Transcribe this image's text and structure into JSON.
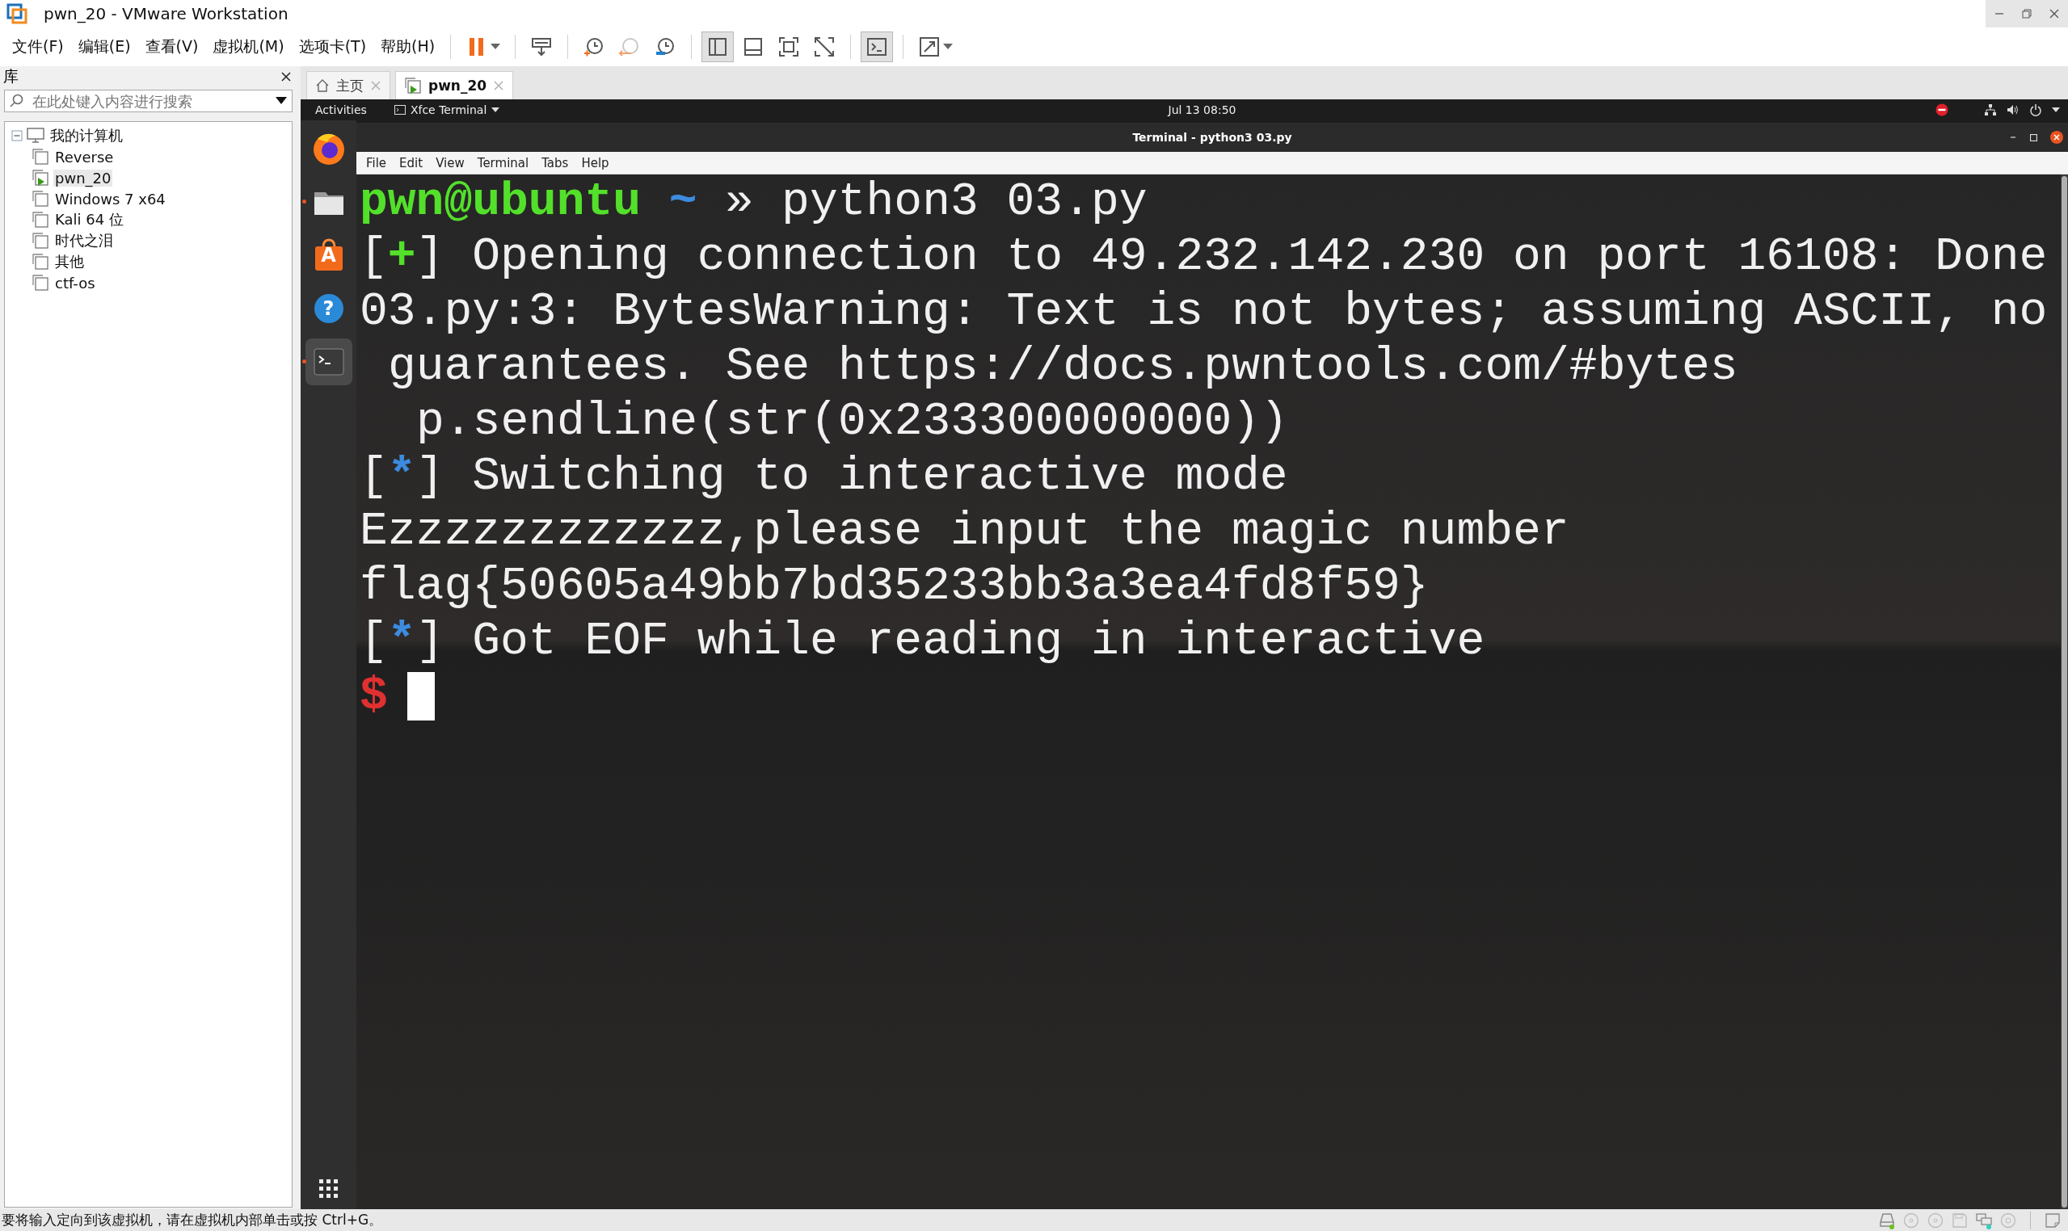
{
  "window": {
    "title": "pwn_20 - VMware Workstation"
  },
  "menu": [
    "文件(F)",
    "编辑(E)",
    "查看(V)",
    "虚拟机(M)",
    "选项卡(T)",
    "帮助(H)"
  ],
  "toolbar": [
    {
      "pressed": false
    },
    {
      "pressed": false
    },
    {
      "pressed": false
    },
    {
      "pressed": false
    },
    {
      "pressed": false
    },
    {
      "pressed": true
    },
    {
      "pressed": false
    },
    {
      "pressed": false
    },
    {
      "pressed": false
    },
    {
      "pressed": true
    },
    {
      "pressed": false
    }
  ],
  "library": {
    "title": "库",
    "search": {
      "placeholder": "在此处键入内容进行搜索"
    },
    "tree": [
      {
        "label": "我的计算机",
        "expanded": true,
        "children": [
          {
            "label": "Reverse",
            "selected": false,
            "running": false
          },
          {
            "label": "pwn_20",
            "selected": true,
            "running": true
          },
          {
            "label": "Windows 7 x64",
            "selected": false,
            "running": false
          },
          {
            "label": "Kali 64 位",
            "selected": false,
            "running": false
          },
          {
            "label": "时代之泪",
            "selected": false,
            "running": false
          },
          {
            "label": "其他",
            "selected": false,
            "running": false
          },
          {
            "label": "ctf-os",
            "selected": false,
            "running": false
          }
        ]
      }
    ]
  },
  "tabs": [
    {
      "label": "主页",
      "selected": false
    },
    {
      "label": "pwn_20",
      "selected": true
    }
  ],
  "guest": {
    "top_bar": {
      "activities": "Activities",
      "app": "Xfce Terminal",
      "clock": "Jul 13  08:50"
    },
    "dock": [
      {
        "running": false
      },
      {
        "running": true
      },
      {
        "running": false,
        "glyph": "A"
      },
      {
        "running": false,
        "glyph": "?"
      },
      {
        "running": true,
        "selected": true
      }
    ],
    "terminal": {
      "title": "Terminal - python3 03.py",
      "menu": [
        "File",
        "Edit",
        "View",
        "Terminal",
        "Tabs",
        "Help"
      ],
      "lines": [
        {
          "kind": "line",
          "segments": [
            {
              "text": "pwn@ubuntu",
              "kind": "user"
            },
            {
              "text": " ~",
              "kind": "path"
            },
            {
              "text": " » python3 03.py",
              "kind": "plain"
            }
          ]
        },
        {
          "kind": "line",
          "segments": [
            {
              "text": "[",
              "kind": "plain"
            },
            {
              "text": "+",
              "kind": "success"
            },
            {
              "text": "] Opening connection to 49.232.142.230 on port 16108: Done",
              "kind": "plain"
            }
          ]
        },
        {
          "kind": "line",
          "segments": [
            {
              "text": "03.py:3: BytesWarning: Text is not bytes; assuming ASCII, no",
              "kind": "plain"
            }
          ]
        },
        {
          "kind": "wrap",
          "segments": [
            {
              "text": "guarantees. See https://docs.pwntools.com/#bytes",
              "kind": "plain"
            }
          ]
        },
        {
          "kind": "source",
          "segments": [
            {
              "text": "p.sendline(str(0x233300000000))",
              "kind": "plain"
            }
          ]
        },
        {
          "kind": "line",
          "segments": [
            {
              "text": "[",
              "kind": "plain"
            },
            {
              "text": "*",
              "kind": "info"
            },
            {
              "text": "] Switching to interactive mode",
              "kind": "plain"
            }
          ]
        },
        {
          "kind": "line",
          "segments": [
            {
              "text": "Ezzzzzzzzzzzz,please input the magic number",
              "kind": "plain"
            }
          ]
        },
        {
          "kind": "line",
          "segments": [
            {
              "text": "flag{50605a49bb7bd35233bb3a3ea4fd8f59}",
              "kind": "plain"
            }
          ]
        },
        {
          "kind": "line",
          "segments": [
            {
              "text": "[",
              "kind": "plain"
            },
            {
              "text": "*",
              "kind": "info"
            },
            {
              "text": "] Got EOF while reading in interactive",
              "kind": "plain"
            }
          ]
        },
        {
          "kind": "line",
          "cursor": true,
          "segments": [
            {
              "text": "$",
              "kind": "shell"
            }
          ]
        }
      ]
    }
  },
  "status_bar": {
    "message": "要将输入定向到该虚拟机，请在虚拟机内部单击或按 Ctrl+G。",
    "devices": [
      {
        "active": true
      },
      {
        "active": false
      },
      {
        "active": false
      },
      {
        "active": false
      },
      {
        "active": true
      },
      {
        "active": false
      }
    ]
  }
}
